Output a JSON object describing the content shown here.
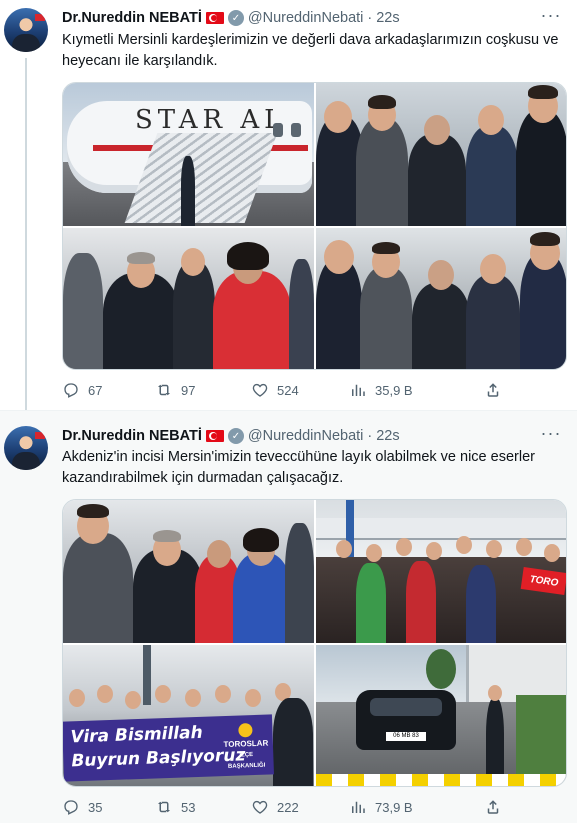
{
  "tweets": [
    {
      "author_name": "Dr.Nureddin NEBATİ",
      "handle": "@NureddinNebati",
      "separator": "·",
      "time": "22s",
      "text": "Kıymetli Mersinli kardeşlerimizin ve değerli dava arkadaşlarımızın coşkusu ve heyecanı ile karşılandık.",
      "aircraft_text": "STAR AL",
      "stats": {
        "replies": "67",
        "retweets": "97",
        "likes": "524",
        "views": "35,9 B"
      }
    },
    {
      "author_name": "Dr.Nureddin NEBATİ",
      "handle": "@NureddinNebati",
      "separator": "·",
      "time": "22s",
      "text": "Akdeniz'in incisi Mersin'imizin teveccühüne layık olabilmek ve nice eserler kazandırabilmek için durmadan çalışacağız.",
      "banner_line1": "Vira Bismillah",
      "banner_line2": "Buyrun Başlıyoruz",
      "banner_org": "TOROSLAR",
      "banner_org_sub": "İLÇE BAŞKANLIĞI",
      "sign_text": "TORO",
      "plate_text": "06 MB 83",
      "stats": {
        "replies": "35",
        "retweets": "53",
        "likes": "222",
        "views": "73,9 B"
      }
    }
  ],
  "icons": {
    "more": "more-icon",
    "verified": "verified-badge-icon",
    "reply": "reply-icon",
    "retweet": "retweet-icon",
    "like": "heart-icon",
    "views": "views-chart-icon",
    "share": "share-icon"
  },
  "colors": {
    "text_primary": "#0f1419",
    "text_secondary": "#536471",
    "thread_line": "#cfd9de",
    "verified_badge": "#829aab",
    "flag_red": "#e30a17"
  }
}
